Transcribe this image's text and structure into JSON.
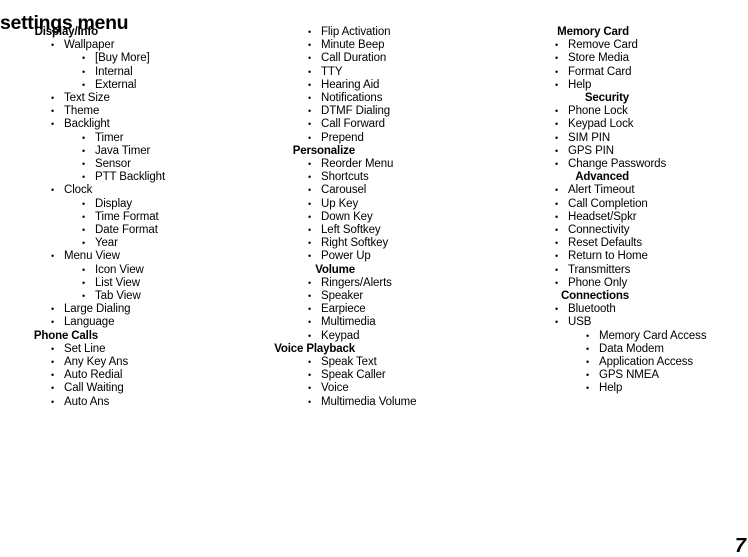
{
  "page": {
    "title": "settings menu",
    "number": "7",
    "bullet_glyph": "•"
  },
  "columns": [
    {
      "id": "col-1",
      "groups": [
        {
          "header": "Display/Info",
          "items": [
            {
              "level": 1,
              "label": "Wallpaper"
            },
            {
              "level": 2,
              "label": "[Buy More]"
            },
            {
              "level": 2,
              "label": "Internal"
            },
            {
              "level": 2,
              "label": "External"
            },
            {
              "level": 1,
              "label": "Text Size"
            },
            {
              "level": 1,
              "label": "Theme"
            },
            {
              "level": 1,
              "label": "Backlight"
            },
            {
              "level": 2,
              "label": "Timer"
            },
            {
              "level": 2,
              "label": "Java Timer"
            },
            {
              "level": 2,
              "label": "Sensor"
            },
            {
              "level": 2,
              "label": "PTT Backlight"
            },
            {
              "level": 1,
              "label": "Clock"
            },
            {
              "level": 2,
              "label": "Display"
            },
            {
              "level": 2,
              "label": "Time Format"
            },
            {
              "level": 2,
              "label": "Date Format"
            },
            {
              "level": 2,
              "label": "Year"
            },
            {
              "level": 1,
              "label": "Menu View"
            },
            {
              "level": 2,
              "label": "Icon View"
            },
            {
              "level": 2,
              "label": "List View"
            },
            {
              "level": 2,
              "label": "Tab View"
            },
            {
              "level": 1,
              "label": "Large Dialing"
            },
            {
              "level": 1,
              "label": "Language"
            }
          ]
        },
        {
          "header": "Phone Calls",
          "items": [
            {
              "level": 1,
              "label": "Set Line"
            },
            {
              "level": 1,
              "label": "Any Key Ans"
            },
            {
              "level": 1,
              "label": "Auto Redial"
            },
            {
              "level": 1,
              "label": "Call Waiting"
            },
            {
              "level": 1,
              "label": "Auto Ans"
            }
          ]
        }
      ]
    },
    {
      "id": "col-2",
      "groups": [
        {
          "header": "",
          "items": [
            {
              "level": 1,
              "label": "Flip Activation"
            },
            {
              "level": 1,
              "label": "Minute Beep"
            },
            {
              "level": 1,
              "label": "Call Duration"
            },
            {
              "level": 1,
              "label": "TTY"
            },
            {
              "level": 1,
              "label": "Hearing Aid"
            },
            {
              "level": 1,
              "label": "Notifications"
            },
            {
              "level": 1,
              "label": "DTMF Dialing"
            },
            {
              "level": 1,
              "label": "Call Forward"
            },
            {
              "level": 1,
              "label": "Prepend"
            }
          ]
        },
        {
          "header": "Personalize",
          "items": [
            {
              "level": 1,
              "label": "Reorder Menu"
            },
            {
              "level": 1,
              "label": "Shortcuts"
            },
            {
              "level": 1,
              "label": "Carousel"
            },
            {
              "level": 1,
              "label": "Up Key"
            },
            {
              "level": 1,
              "label": "Down Key"
            },
            {
              "level": 1,
              "label": "Left Softkey"
            },
            {
              "level": 1,
              "label": "Right Softkey"
            },
            {
              "level": 1,
              "label": "Power Up"
            }
          ]
        },
        {
          "header": "Volume",
          "items": [
            {
              "level": 1,
              "label": "Ringers/Alerts"
            },
            {
              "level": 1,
              "label": "Speaker"
            },
            {
              "level": 1,
              "label": "Earpiece"
            },
            {
              "level": 1,
              "label": "Multimedia"
            },
            {
              "level": 1,
              "label": "Keypad"
            }
          ]
        },
        {
          "header": "Voice Playback",
          "items": [
            {
              "level": 1,
              "label": "Speak Text"
            },
            {
              "level": 1,
              "label": "Speak Caller"
            },
            {
              "level": 1,
              "label": "Voice"
            },
            {
              "level": 1,
              "label": "Multimedia Volume"
            }
          ]
        }
      ]
    },
    {
      "id": "col-3",
      "groups": [
        {
          "header": "Memory Card",
          "items": [
            {
              "level": 1,
              "label": "Remove Card"
            },
            {
              "level": 1,
              "label": "Store Media"
            },
            {
              "level": 1,
              "label": "Format Card"
            },
            {
              "level": 1,
              "label": "Help"
            }
          ]
        },
        {
          "header": "Security",
          "items": [
            {
              "level": 1,
              "label": "Phone Lock"
            },
            {
              "level": 1,
              "label": "Keypad Lock"
            },
            {
              "level": 1,
              "label": "SIM PIN"
            },
            {
              "level": 1,
              "label": "GPS PIN"
            },
            {
              "level": 1,
              "label": "Change Passwords"
            }
          ]
        },
        {
          "header": "Advanced",
          "items": [
            {
              "level": 1,
              "label": "Alert Timeout"
            },
            {
              "level": 1,
              "label": "Call Completion"
            },
            {
              "level": 1,
              "label": "Headset/Spkr"
            },
            {
              "level": 1,
              "label": "Connectivity"
            },
            {
              "level": 1,
              "label": "Reset Defaults"
            },
            {
              "level": 1,
              "label": "Return to Home"
            },
            {
              "level": 1,
              "label": "Transmitters"
            },
            {
              "level": 1,
              "label": "Phone Only"
            }
          ]
        },
        {
          "header": "Connections",
          "items": [
            {
              "level": 1,
              "label": "Bluetooth"
            },
            {
              "level": 1,
              "label": "USB"
            },
            {
              "level": 2,
              "label": "Memory Card Access"
            },
            {
              "level": 2,
              "label": "Data Modem"
            },
            {
              "level": 2,
              "label": "Application Access"
            },
            {
              "level": 2,
              "label": "GPS NMEA"
            },
            {
              "level": 2,
              "label": "Help"
            }
          ]
        }
      ]
    }
  ]
}
